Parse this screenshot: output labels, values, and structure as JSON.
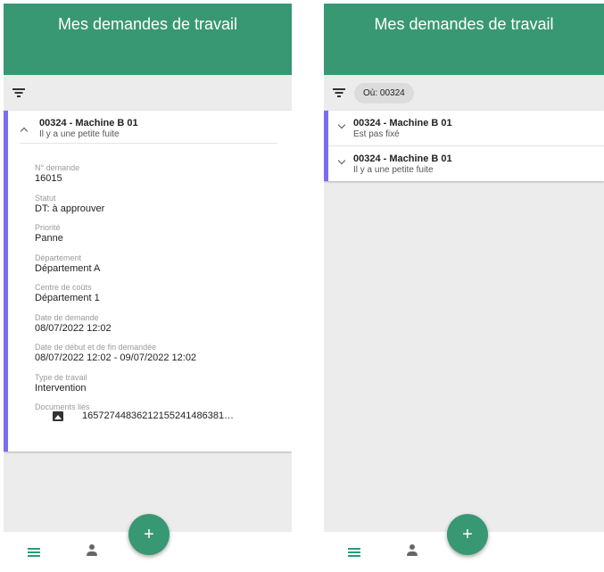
{
  "left_screen": {
    "app_title": "Mes demandes de travail",
    "card": {
      "title": "00324 - Machine B 01",
      "subtitle": "Il y a une petite fuite",
      "fields": [
        {
          "label": "N° demande",
          "value": "16015"
        },
        {
          "label": "Statut",
          "value": "DT: à approuver"
        },
        {
          "label": "Priorité",
          "value": "Panne"
        },
        {
          "label": "Département",
          "value": "Département A"
        },
        {
          "label": "Centre de coûts",
          "value": "Département 1"
        },
        {
          "label": "Date de demande",
          "value": "08/07/2022 12:02"
        },
        {
          "label": "Date de début et de fin demandée",
          "value": "08/07/2022 12:02 - 09/07/2022 12:02"
        },
        {
          "label": "Type de travail",
          "value": "Intervention"
        }
      ],
      "documents_label": "Documents liés",
      "document_name": "16572744836212155241486381…"
    },
    "fab_label": "+"
  },
  "right_screen": {
    "app_title": "Mes demandes de travail",
    "filter_chip": "Où: 00324",
    "items": [
      {
        "title": "00324 - Machine B 01",
        "subtitle": "Est pas fixé"
      },
      {
        "title": "00324 - Machine B 01",
        "subtitle": "Il y a une petite fuite"
      }
    ],
    "fab_label": "+"
  },
  "colors": {
    "primary": "#389873",
    "accent_border": "#7c6cf0",
    "background": "#ececec"
  },
  "icons": {
    "filter": "filter-icon",
    "expand": "chevron-up-icon",
    "collapse": "chevron-down-icon",
    "document": "image-icon",
    "nav_list": "list-icon",
    "nav_profile": "person-icon"
  }
}
